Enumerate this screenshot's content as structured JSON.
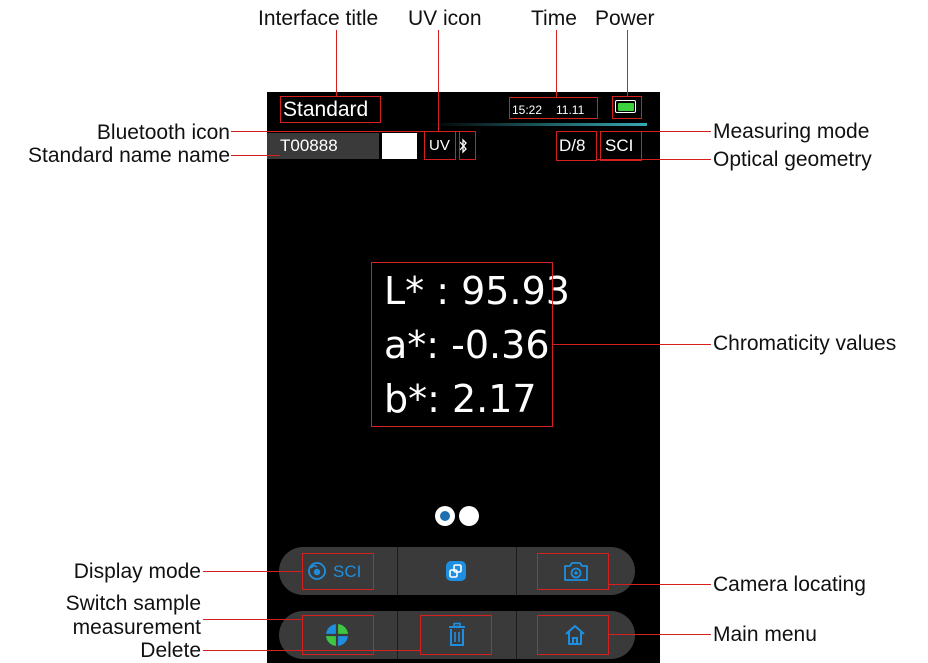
{
  "screen": {
    "title": "Standard",
    "time": "15:22",
    "date": "11.11",
    "standard_name": "T00888",
    "uv": "UV",
    "geometry": "D/8",
    "measure_mode": "SCI",
    "values": {
      "L": "L* : 95.93",
      "a": "a*: -0.36",
      "b": "b*: 2.17"
    },
    "page_indicator": {
      "pages": 2,
      "active": 0
    },
    "display_mode_label": "SCI",
    "accent_color": "#1e8fe0",
    "battery_color": "#3ed13e"
  },
  "annotations": {
    "interface_title": "Interface title",
    "uv_icon": "UV icon",
    "time": "Time",
    "power": "Power",
    "bluetooth_icon": "Bluetooth icon",
    "standard_name": "Standard name name",
    "measuring_mode": "Measuring mode",
    "optical_geometry": "Optical geometry",
    "chromaticity_values": "Chromaticity values",
    "display_mode": "Display mode",
    "switch_sample_line1": "Switch sample",
    "switch_sample_line2": "measurement",
    "delete": "Delete",
    "camera_locating": "Camera locating",
    "main_menu": "Main menu"
  },
  "icons": [
    "bluetooth-icon",
    "battery-icon",
    "sensor-icon",
    "switch-icon",
    "camera-icon",
    "crosshair-icon",
    "trash-icon",
    "home-icon"
  ]
}
